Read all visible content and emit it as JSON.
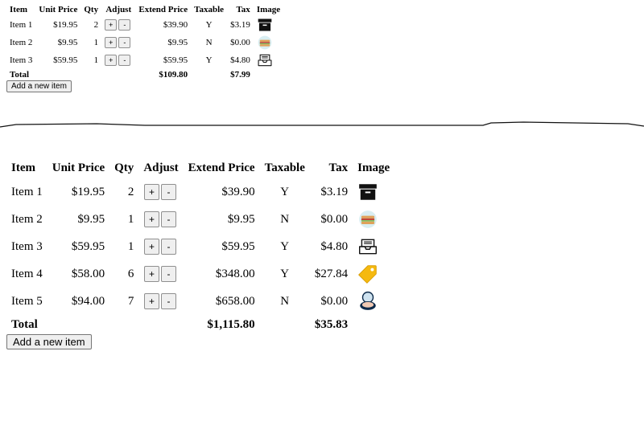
{
  "headers": {
    "item": "Item",
    "unit_price": "Unit Price",
    "qty": "Qty",
    "adjust": "Adjust",
    "extend_price": "Extend Price",
    "taxable": "Taxable",
    "tax": "Tax",
    "image": "Image"
  },
  "buttons": {
    "plus": "+",
    "minus": "-",
    "add_item": "Add a new item"
  },
  "small_table": {
    "rows": [
      {
        "item": "Item 1",
        "unit_price": "$19.95",
        "qty": "2",
        "extend": "$39.90",
        "taxable": "Y",
        "tax": "$3.19",
        "icon": "archive-box-icon"
      },
      {
        "item": "Item 2",
        "unit_price": "$9.95",
        "qty": "1",
        "extend": "$9.95",
        "taxable": "N",
        "tax": "$0.00",
        "icon": "food-sandwich-icon"
      },
      {
        "item": "Item 3",
        "unit_price": "$59.95",
        "qty": "1",
        "extend": "$59.95",
        "taxable": "Y",
        "tax": "$4.80",
        "icon": "inbox-tray-icon"
      }
    ],
    "total": {
      "label": "Total",
      "extend": "$109.80",
      "tax": "$7.99"
    }
  },
  "large_table": {
    "rows": [
      {
        "item": "Item 1",
        "unit_price": "$19.95",
        "qty": "2",
        "extend": "$39.90",
        "taxable": "Y",
        "tax": "$3.19",
        "icon": "archive-box-icon"
      },
      {
        "item": "Item 2",
        "unit_price": "$9.95",
        "qty": "1",
        "extend": "$9.95",
        "taxable": "N",
        "tax": "$0.00",
        "icon": "food-sandwich-icon"
      },
      {
        "item": "Item 3",
        "unit_price": "$59.95",
        "qty": "1",
        "extend": "$59.95",
        "taxable": "Y",
        "tax": "$4.80",
        "icon": "inbox-tray-icon"
      },
      {
        "item": "Item 4",
        "unit_price": "$58.00",
        "qty": "6",
        "extend": "$348.00",
        "taxable": "Y",
        "tax": "$27.84",
        "icon": "price-tag-icon"
      },
      {
        "item": "Item 5",
        "unit_price": "$94.00",
        "qty": "7",
        "extend": "$658.00",
        "taxable": "N",
        "tax": "$0.00",
        "icon": "compact-powder-icon"
      }
    ],
    "total": {
      "label": "Total",
      "extend": "$1,115.80",
      "tax": "$35.83"
    }
  },
  "colors": {
    "tag": "#f5b90f",
    "box": "#111111",
    "powder_case": "#0d2a4a",
    "powder": "#f0c9b3"
  }
}
